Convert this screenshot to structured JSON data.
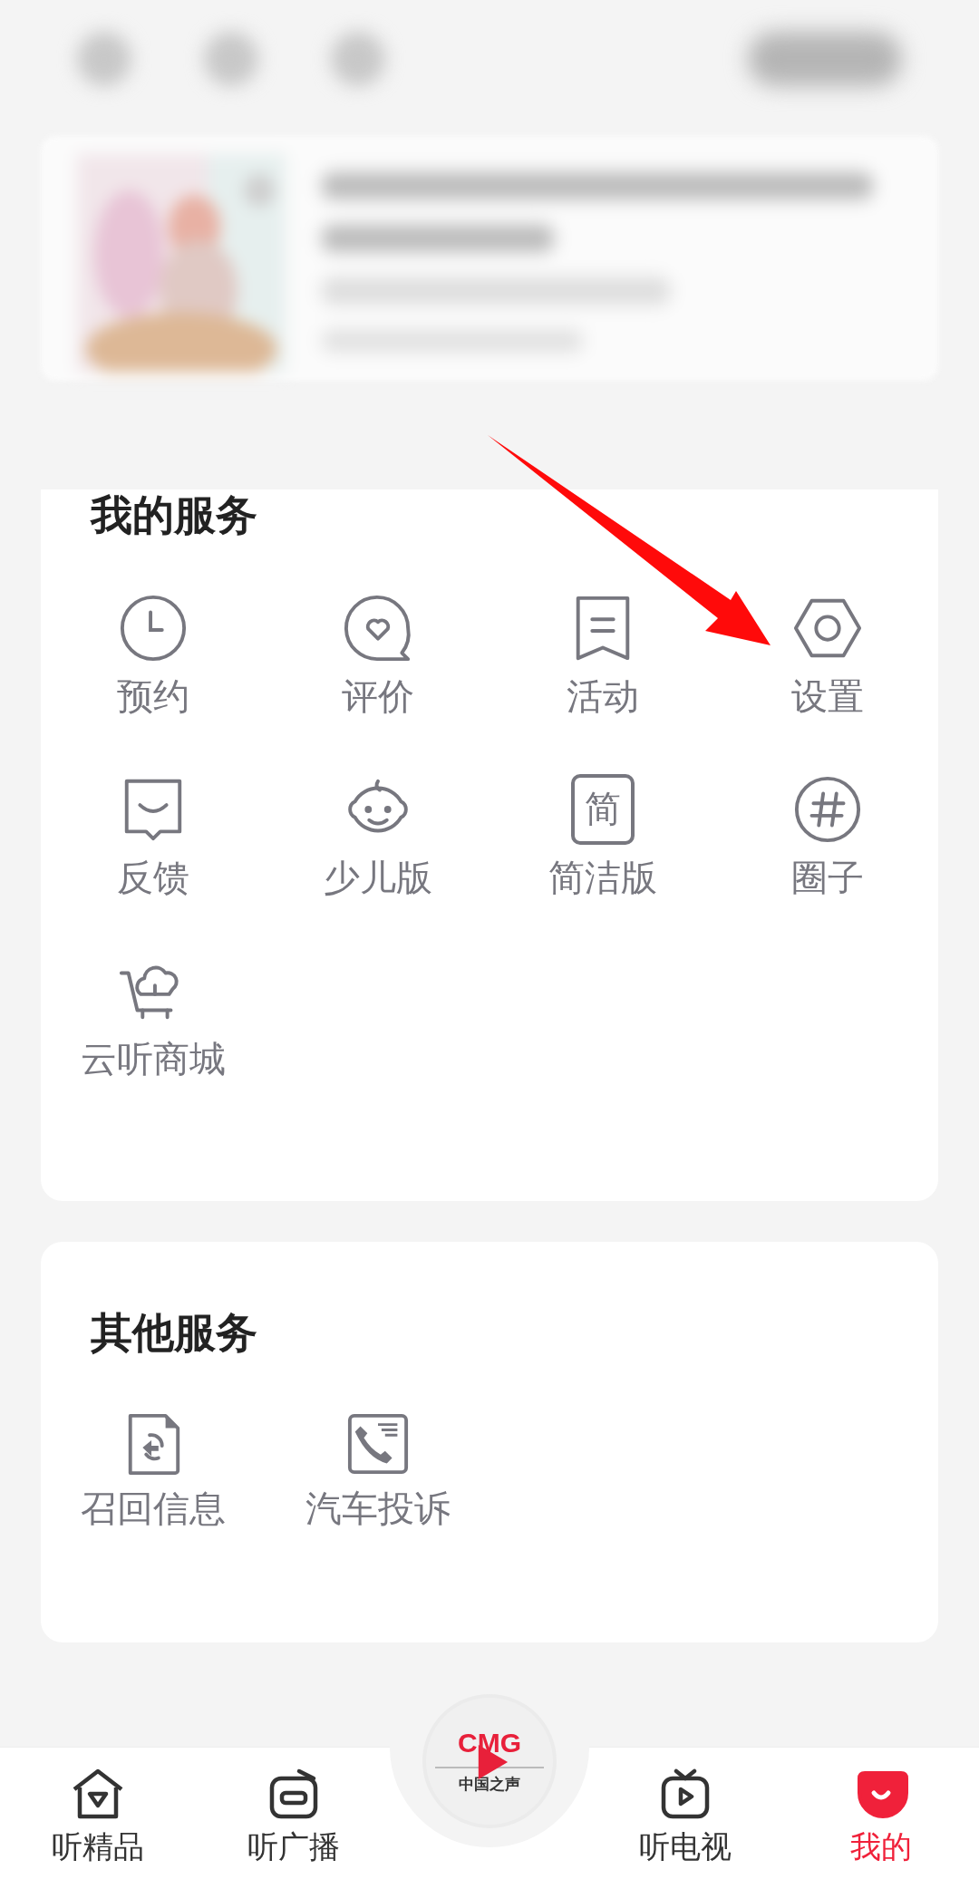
{
  "my_services": {
    "title": "我的服务",
    "items": [
      {
        "label": "预约",
        "kind": "clock"
      },
      {
        "label": "评价",
        "kind": "heart-bubble"
      },
      {
        "label": "活动",
        "kind": "bookmark"
      },
      {
        "label": "设置",
        "kind": "hexagon"
      },
      {
        "label": "反馈",
        "kind": "feedback"
      },
      {
        "label": "少儿版",
        "kind": "baby"
      },
      {
        "label": "简洁版",
        "kind": "char-box",
        "icon_text": "简"
      },
      {
        "label": "圈子",
        "kind": "hash"
      },
      {
        "label": "云听商城",
        "kind": "cart"
      }
    ]
  },
  "other_services": {
    "title": "其他服务",
    "items": [
      {
        "label": "召回信息",
        "kind": "recall-doc"
      },
      {
        "label": "汽车投诉",
        "kind": "phone-doc"
      }
    ]
  },
  "center_logo": {
    "brand": "CMG",
    "caption": "中国之声"
  },
  "nav": [
    {
      "label": "听精品",
      "kind": "home",
      "selected": false
    },
    {
      "label": "听广播",
      "kind": "radio",
      "selected": false
    },
    {
      "label": "听电视",
      "kind": "tv",
      "selected": false
    },
    {
      "label": "我的",
      "kind": "mine",
      "selected": true
    }
  ]
}
